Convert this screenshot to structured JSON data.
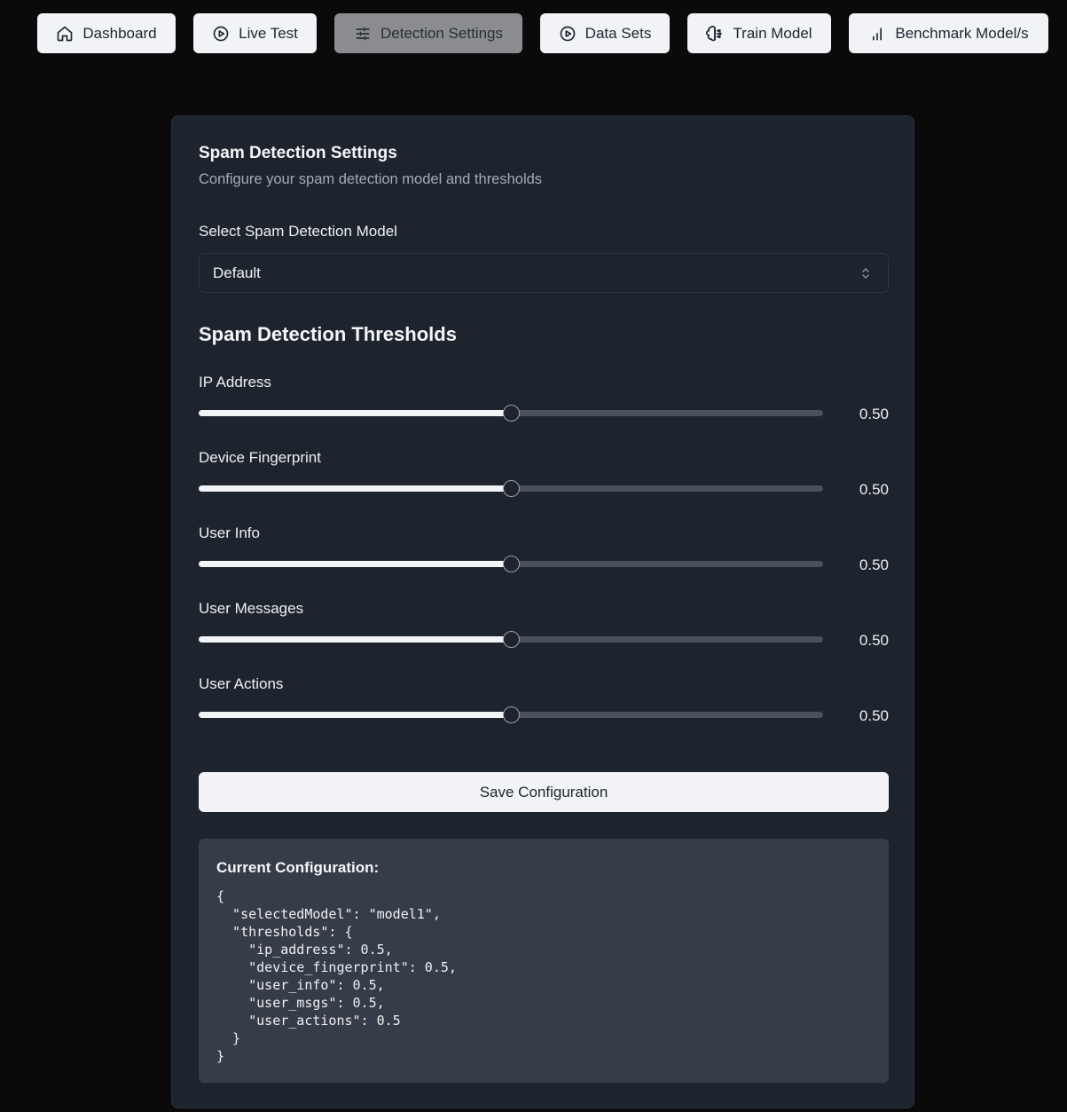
{
  "nav": {
    "items": [
      {
        "label": "Dashboard",
        "icon": "home-icon"
      },
      {
        "label": "Live Test",
        "icon": "play-circle-icon"
      },
      {
        "label": "Detection Settings",
        "icon": "sliders-icon",
        "active": true
      },
      {
        "label": "Data Sets",
        "icon": "play-circle-icon"
      },
      {
        "label": "Train Model",
        "icon": "brain-icon"
      },
      {
        "label": "Benchmark Model/s",
        "icon": "bar-chart-icon"
      }
    ]
  },
  "settings": {
    "title": "Spam Detection Settings",
    "subtitle": "Configure your spam detection model and thresholds",
    "model_label": "Select Spam Detection Model",
    "model_value": "Default",
    "thresholds_title": "Spam Detection Thresholds",
    "sliders": [
      {
        "label": "IP Address",
        "value": 0.5,
        "display": "0.50"
      },
      {
        "label": "Device Fingerprint",
        "value": 0.5,
        "display": "0.50"
      },
      {
        "label": "User Info",
        "value": 0.5,
        "display": "0.50"
      },
      {
        "label": "User Messages",
        "value": 0.5,
        "display": "0.50"
      },
      {
        "label": "User Actions",
        "value": 0.5,
        "display": "0.50"
      }
    ],
    "save_label": "Save Configuration",
    "config_title": "Current Configuration:",
    "config_json": "{\n  \"selectedModel\": \"model1\",\n  \"thresholds\": {\n    \"ip_address\": 0.5,\n    \"device_fingerprint\": 0.5,\n    \"user_info\": 0.5,\n    \"user_msgs\": 0.5,\n    \"user_actions\": 0.5\n  }\n}"
  },
  "colors": {
    "page_bg": "#0a0a0a",
    "card_bg": "#1e242e",
    "button_bg": "#f1f3f6",
    "active_button_bg": "#8a8c90"
  }
}
